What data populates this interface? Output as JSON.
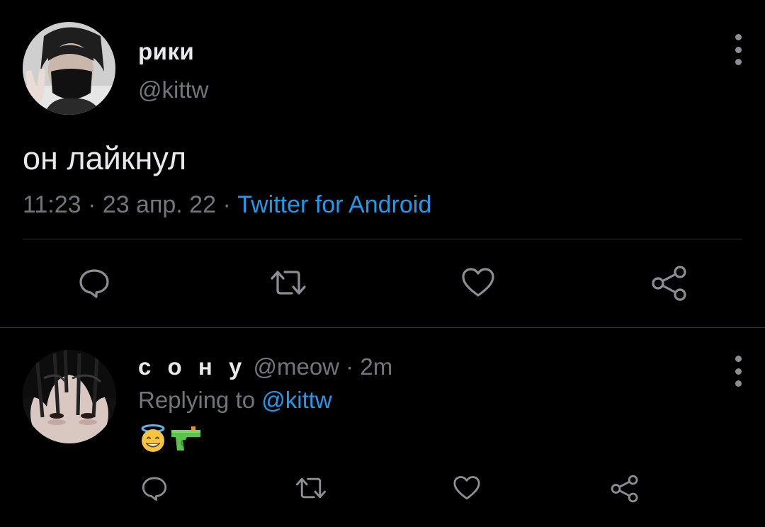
{
  "main_tweet": {
    "display_name": "рики",
    "handle": "@kittw",
    "text": "он лайкнул",
    "time": "11:23",
    "separator": " · ",
    "date": "23 апр. 22",
    "source": "Twitter for Android",
    "avatar_icon": "user-avatar-photo",
    "more_icon": "more-vertical-icon"
  },
  "reply": {
    "display_name": "с о н у",
    "handle": "@meow",
    "separator": " · ",
    "age": "2m",
    "replying_prefix": "Replying to ",
    "replying_to": "@kittw",
    "emojis": [
      "smiling-face-with-halo-emoji",
      "water-pistol-emoji"
    ],
    "more_icon": "more-vertical-icon"
  },
  "actions": [
    "reply-icon",
    "retweet-icon",
    "like-icon",
    "share-icon"
  ],
  "colors": {
    "background": "#000000",
    "primary_text": "#e7e9ea",
    "secondary_text": "#71767b",
    "link": "#1d9bf0",
    "icon": "#8b8f94",
    "divider": "#2f3336"
  }
}
